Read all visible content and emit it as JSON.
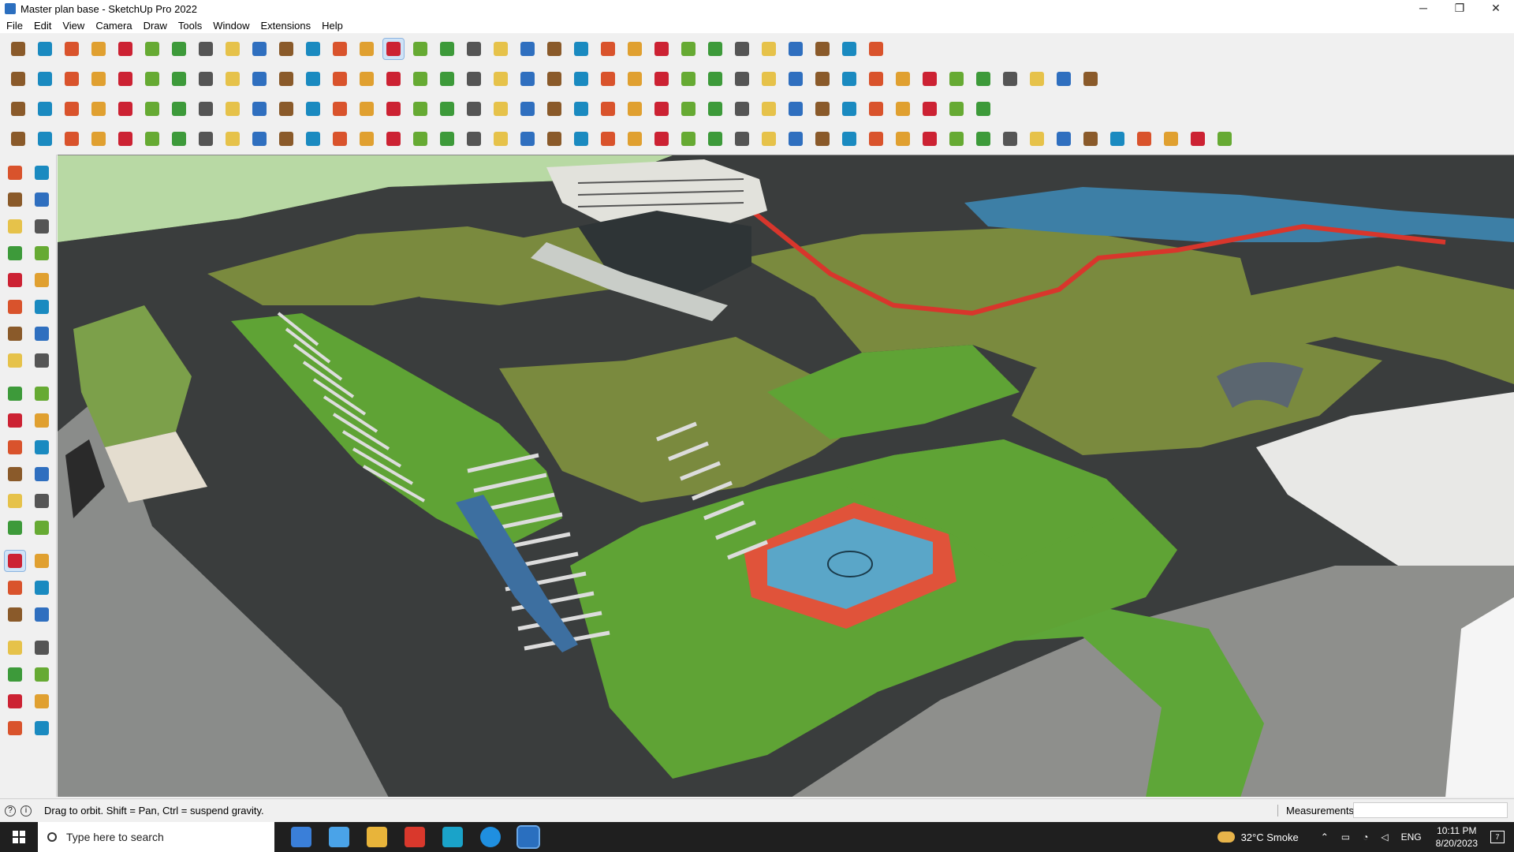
{
  "window": {
    "title": "Master plan base - SketchUp Pro 2022"
  },
  "window_controls": {
    "minimize": "─",
    "maximize": "❐",
    "close": "✕"
  },
  "menu": [
    "File",
    "Edit",
    "View",
    "Camera",
    "Draw",
    "Tools",
    "Window",
    "Extensions",
    "Help"
  ],
  "statusbar": {
    "hint": "Drag to orbit. Shift = Pan, Ctrl = suspend gravity.",
    "measurements_label": "Measurements",
    "measurements_value": ""
  },
  "taskbar": {
    "search_placeholder": "Type here to search",
    "weather": "32°C  Smoke",
    "language": "ENG",
    "time": "10:11 PM",
    "date": "8/20/2023",
    "notification_count": "7"
  },
  "colors": {
    "grass": "#5f9a35",
    "lawn_olive": "#7e8a3e",
    "road": "#3a3d3d",
    "water": "#3d7fa6",
    "court_red": "#e0533a",
    "court_blue": "#5aa6c8",
    "path_red": "#d8362c",
    "toolbar_active": "#cfe3f7"
  },
  "toolbars": {
    "row1": [
      "zoom-icon",
      "select-icon",
      "eraser-icon",
      "pencil-icon",
      "arc-icon",
      "rect-icon",
      "pushpull-icon",
      "followme-icon",
      "move-icon",
      "rotate-icon",
      "scale-icon",
      "tape-icon",
      "text-icon",
      "paint-icon",
      "orbit-icon",
      "pan-icon",
      "zoom-window-icon",
      "zoom-extents-icon",
      "section-icon",
      "section-display-icon",
      "section-cut-icon",
      "sandbox-icon",
      "user-icon",
      "layer-icon",
      "layer2-icon",
      "axes-icon",
      "arrow-up-icon",
      "arrows-icon",
      "dimension-icon",
      "view-icon",
      "undo-icon",
      "redo-icon",
      "extension-icon"
    ],
    "row2": [
      "box-icon",
      "box2-icon",
      "box3-icon",
      "move-red-icon",
      "iso-icon",
      "top-icon",
      "front-icon",
      "right-icon",
      "back-icon",
      "left-icon",
      "bottom-icon",
      "style-icon",
      "xray-icon",
      "hidden-icon",
      "wireframe-icon",
      "shaded-icon",
      "textured-icon",
      "house-icon",
      "house2-icon",
      "house3-icon",
      "house4-icon",
      "house5-icon",
      "scenes-icon",
      "tag-icon",
      "solid-icon",
      "outer-icon",
      "intersect-icon",
      "union-icon",
      "subtract-icon",
      "trim-icon",
      "split-icon",
      "shapes-icon",
      "ruby-icon",
      "ext-icon",
      "warehouse-icon",
      "paint2-icon",
      "grid-icon",
      "terrain-icon",
      "hand-icon",
      "map-icon",
      "plugin-icon"
    ],
    "row3": [
      "cube-blue-icon",
      "diamond-icon",
      "plane-icon",
      "label-icon",
      "red-cube-icon",
      "copy-icon",
      "undo2-icon",
      "red-square-icon",
      "panel-icon",
      "page-icon",
      "chair-icon",
      "chain-icon",
      "curve-icon",
      "dots-icon",
      "cross-red-icon",
      "cross-green-icon",
      "cross-blue-icon",
      "cone-icon",
      "triangle-icon",
      "rotate2-icon",
      "star-icon",
      "spin-icon",
      "spark-icon",
      "box-brown-icon",
      "return-icon",
      "green-tool-icon",
      "gear-red-icon",
      "gear2-icon",
      "red-dot-icon",
      "grid2-icon",
      "grid3-icon",
      "orange-grid-icon",
      "orange-grid2-icon",
      "orange-grid3-icon",
      "x-icon",
      "dashed-circle-icon",
      "qr-icon"
    ],
    "row4": [
      "line-icon",
      "dotted-curve-icon",
      "car-icon",
      "wire-icon",
      "hand2-icon",
      "rope-icon",
      "hose-icon",
      "cylinder-icon",
      "sphere-icon",
      "stair-icon",
      "corner-icon",
      "curve2-icon",
      "slope-icon",
      "arc2-icon",
      "box4-icon",
      "tent-icon",
      "rail-icon",
      "fence-icon",
      "bridge-icon",
      "leaf-icon",
      "wing-icon",
      "feather-icon",
      "board-icon",
      "lines-icon",
      "stack-icon",
      "pipe-icon",
      "spring-icon",
      "grid4-icon",
      "fan-icon",
      "ramp-icon",
      "arch-icon",
      "wave-icon",
      "blocks-icon",
      "slab-icon",
      "comb-icon",
      "barrel-icon",
      "cage-icon",
      "net-icon",
      "mesh-icon",
      "weave-icon",
      "wheel-icon",
      "spider-icon",
      "gate-icon",
      "shield-icon",
      "web-icon",
      "wreath-icon"
    ]
  }
}
